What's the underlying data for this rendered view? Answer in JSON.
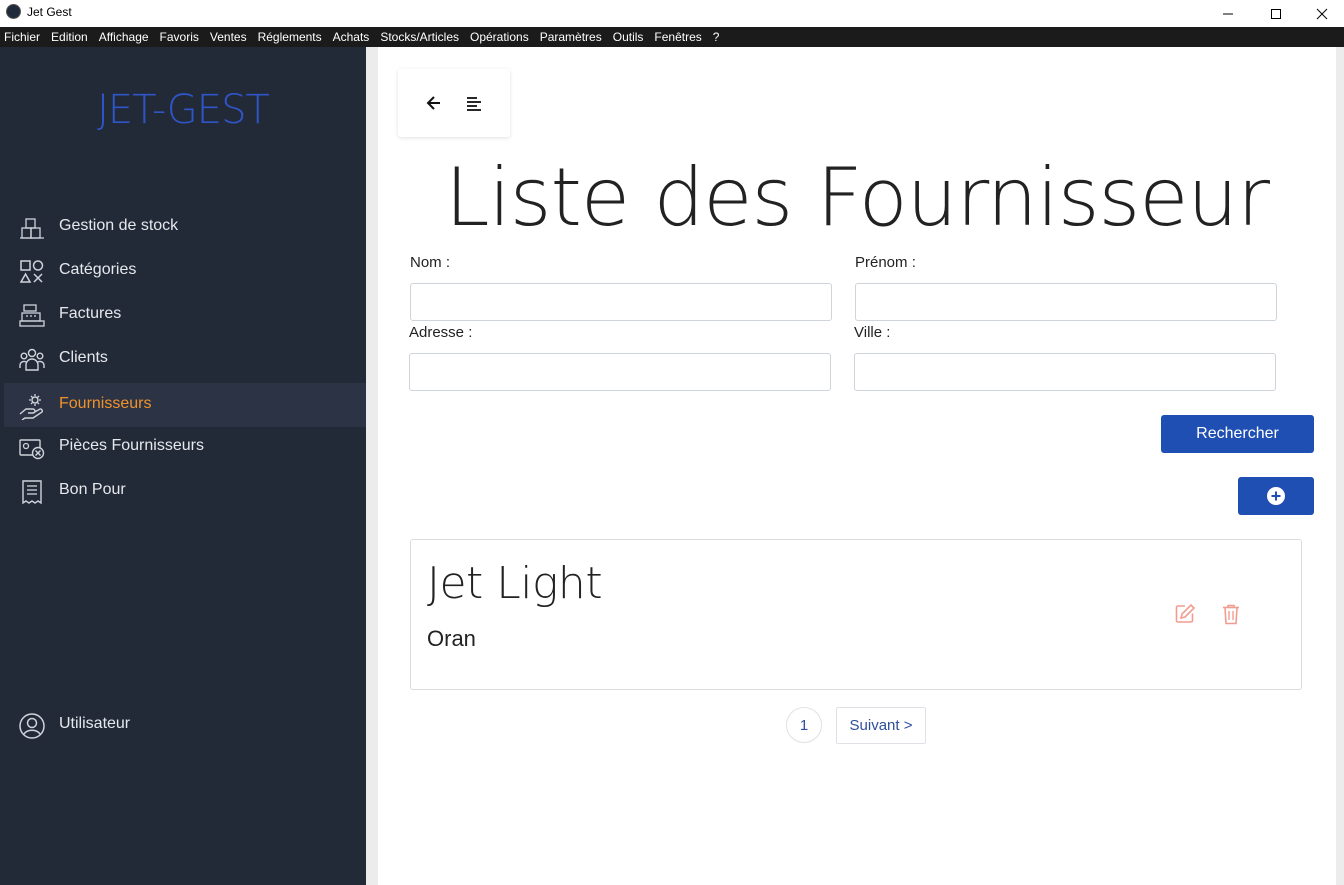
{
  "window": {
    "title": "Jet Gest"
  },
  "menu": [
    "Fichier",
    "Edition",
    "Affichage",
    "Favoris",
    "Ventes",
    "Réglements",
    "Achats",
    "Stocks/Articles",
    "Opérations",
    "Paramètres",
    "Outils",
    "Fenêtres",
    "?"
  ],
  "sidebar": {
    "brand": "JET-GEST",
    "items": [
      {
        "label": "Gestion de stock",
        "icon": "boxes-icon"
      },
      {
        "label": "Catégories",
        "icon": "categories-icon"
      },
      {
        "label": "Factures",
        "icon": "cash-register-icon"
      },
      {
        "label": "Clients",
        "icon": "users-icon"
      },
      {
        "label": "Fournisseurs",
        "icon": "supplier-hand-icon",
        "active": true
      },
      {
        "label": "Pièces Fournisseurs",
        "icon": "document-cancel-icon"
      },
      {
        "label": "Bon Pour",
        "icon": "receipt-icon"
      }
    ],
    "user": {
      "label": "Utilisateur",
      "icon": "user-circle-icon"
    }
  },
  "toolbar": {
    "back_icon": "arrow-left-icon",
    "menu_icon": "align-left-icon"
  },
  "page": {
    "title": "Liste des Fournisseur"
  },
  "form": {
    "nom_label": "Nom :",
    "nom_value": "",
    "prenom_label": "Prénom :",
    "prenom_value": "",
    "adresse_label": "Adresse :",
    "adresse_value": "",
    "ville_label": "Ville :",
    "ville_value": "",
    "search_button": "Rechercher",
    "add_icon": "plus-circle-icon"
  },
  "suppliers": [
    {
      "name": "Jet Light",
      "city": "Oran"
    }
  ],
  "pagination": {
    "current": "1",
    "next": "Suivant >"
  },
  "colors": {
    "sidebar_bg": "#222a38",
    "brand": "#2f55c8",
    "active": "#f0922b",
    "primary_button": "#1f4fb3",
    "action_icon": "#f19c8f"
  }
}
